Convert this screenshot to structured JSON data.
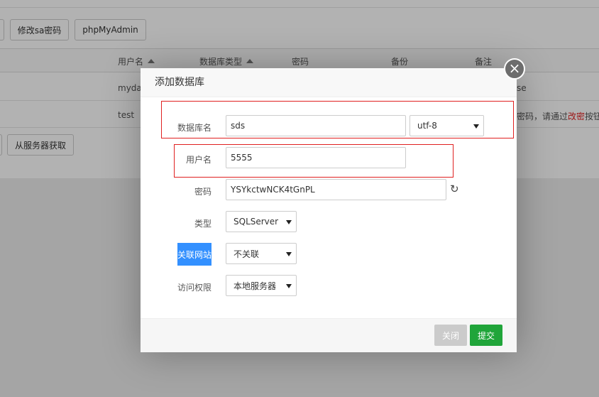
{
  "background": {
    "toolbar": {
      "change_sa_password": "修改sa密码",
      "phpmyadmin": "phpMyAdmin"
    },
    "table": {
      "headers": [
        "用户名",
        "数据库类型",
        "密码",
        "备份",
        "备注"
      ],
      "rows": [
        {
          "username": "myda",
          "note": "se"
        },
        {
          "username": "test",
          "note_prefix": "密码，请通过",
          "note_link": "改密",
          "note_suffix": "按钮"
        }
      ]
    },
    "fetch_from_server": "从服务器获取"
  },
  "dialog": {
    "title": "添加数据库",
    "fields": {
      "db_name": {
        "label": "数据库名",
        "value": "sds",
        "charset": "utf-8"
      },
      "username": {
        "label": "用户名",
        "value": "5555"
      },
      "password": {
        "label": "密码",
        "value": "YSYkctwNCK4tGnPL"
      },
      "type": {
        "label": "类型",
        "value": "SQLServer"
      },
      "linked_site": {
        "label": "关联网站",
        "value": "不关联"
      },
      "access": {
        "label": "访问权限",
        "value": "本地服务器"
      }
    },
    "buttons": {
      "close": "关闭",
      "submit": "提交"
    },
    "close_glyph": "×",
    "refresh_glyph": "↻"
  },
  "colors": {
    "submit_green": "#20a53a",
    "close_gray": "#cbcbcb",
    "highlight_blue": "#3390ff",
    "annotation_red": "#e02020"
  }
}
